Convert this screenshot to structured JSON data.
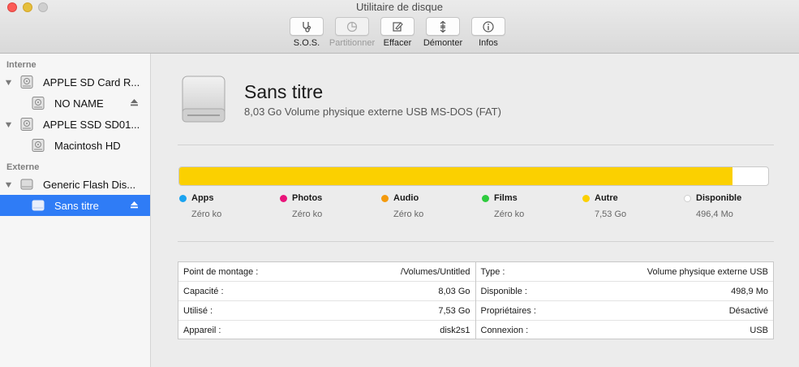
{
  "window": {
    "title": "Utilitaire de disque"
  },
  "toolbar": {
    "sos": "S.O.S.",
    "partition": "Partitionner",
    "erase": "Effacer",
    "unmount": "Démonter",
    "info": "Infos"
  },
  "sidebar": {
    "internal_header": "Interne",
    "external_header": "Externe",
    "items": [
      {
        "label": "APPLE SD Card R..."
      },
      {
        "label": "NO NAME"
      },
      {
        "label": "APPLE SSD SD01..."
      },
      {
        "label": "Macintosh HD"
      },
      {
        "label": "Generic Flash Dis..."
      },
      {
        "label": "Sans titre"
      }
    ]
  },
  "volume": {
    "name": "Sans titre",
    "description": "8,03 Go Volume physique externe USB MS-DOS (FAT)"
  },
  "usage": {
    "used_fraction": 0.939,
    "legend": [
      {
        "name": "Apps",
        "value": "Zéro ko",
        "color": "#1aa3f0"
      },
      {
        "name": "Photos",
        "value": "Zéro ko",
        "color": "#e9147a"
      },
      {
        "name": "Audio",
        "value": "Zéro ko",
        "color": "#f49a0c"
      },
      {
        "name": "Films",
        "value": "Zéro ko",
        "color": "#2ecb3e"
      },
      {
        "name": "Autre",
        "value": "7,53 Go",
        "color": "#fbd000"
      },
      {
        "name": "Disponible",
        "value": "496,4 Mo",
        "color": "#ffffff"
      }
    ]
  },
  "info": {
    "left": [
      {
        "label": "Point de montage :",
        "value": "/Volumes/Untitled"
      },
      {
        "label": "Capacité :",
        "value": "8,03 Go"
      },
      {
        "label": "Utilisé :",
        "value": "7,53 Go"
      },
      {
        "label": "Appareil :",
        "value": "disk2s1"
      }
    ],
    "right": [
      {
        "label": "Type :",
        "value": "Volume physique externe USB"
      },
      {
        "label": "Disponible :",
        "value": "498,9 Mo"
      },
      {
        "label": "Propriétaires :",
        "value": "Désactivé"
      },
      {
        "label": "Connexion :",
        "value": "USB"
      }
    ]
  },
  "icons": {
    "sos": "stethoscope-icon",
    "partition": "pie-icon",
    "erase": "eraser-icon",
    "unmount": "unmount-icon",
    "info": "info-icon",
    "disk": "hard-disk-icon",
    "eject": "eject-icon"
  }
}
